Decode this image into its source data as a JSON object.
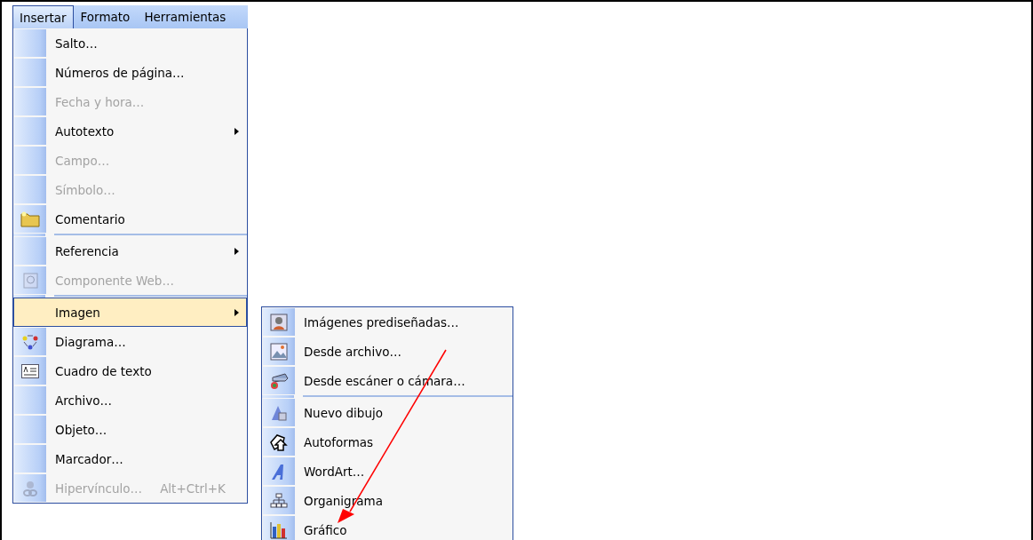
{
  "menubar": [
    {
      "label": "Insertar",
      "selected": true
    },
    {
      "label": "Formato",
      "selected": false
    },
    {
      "label": "Herramientas",
      "selected": false
    }
  ],
  "menu": [
    {
      "kind": "item",
      "label": "Salto…",
      "disabled": false,
      "has_submenu": false,
      "selected": false
    },
    {
      "kind": "item",
      "label": "Números de página…",
      "disabled": false,
      "has_submenu": false,
      "selected": false
    },
    {
      "kind": "item",
      "label": "Fecha y hora…",
      "disabled": true,
      "has_submenu": false,
      "selected": false
    },
    {
      "kind": "item",
      "label": "Autotexto",
      "disabled": false,
      "has_submenu": true,
      "selected": false
    },
    {
      "kind": "item",
      "label": "Campo…",
      "disabled": true,
      "has_submenu": false,
      "selected": false
    },
    {
      "kind": "item",
      "label": "Símbolo…",
      "disabled": true,
      "has_submenu": false,
      "selected": false
    },
    {
      "kind": "item",
      "label": "Comentario",
      "disabled": false,
      "has_submenu": false,
      "selected": false
    },
    {
      "kind": "separator"
    },
    {
      "kind": "item",
      "label": "Referencia",
      "disabled": false,
      "has_submenu": true,
      "selected": false
    },
    {
      "kind": "item",
      "label": "Componente Web…",
      "disabled": true,
      "has_submenu": false,
      "selected": false
    },
    {
      "kind": "separator"
    },
    {
      "kind": "item",
      "label": "Imagen",
      "disabled": false,
      "has_submenu": true,
      "selected": true
    },
    {
      "kind": "item",
      "label": "Diagrama…",
      "disabled": false,
      "has_submenu": false,
      "selected": false
    },
    {
      "kind": "item",
      "label": "Cuadro de texto",
      "disabled": false,
      "has_submenu": false,
      "selected": false
    },
    {
      "kind": "item",
      "label": "Archivo…",
      "disabled": false,
      "has_submenu": false,
      "selected": false
    },
    {
      "kind": "item",
      "label": "Objeto…",
      "disabled": false,
      "has_submenu": false,
      "selected": false
    },
    {
      "kind": "item",
      "label": "Marcador…",
      "disabled": false,
      "has_submenu": false,
      "selected": false
    },
    {
      "kind": "item",
      "label": "Hipervínculo…",
      "shortcut": "Alt+Ctrl+K",
      "disabled": true,
      "has_submenu": false,
      "selected": false
    }
  ],
  "submenu": [
    {
      "kind": "item",
      "label": "Imágenes prediseñadas…"
    },
    {
      "kind": "item",
      "label": "Desde archivo…"
    },
    {
      "kind": "item",
      "label": "Desde escáner o cámara…"
    },
    {
      "kind": "separator"
    },
    {
      "kind": "item",
      "label": "Nuevo dibujo"
    },
    {
      "kind": "item",
      "label": "Autoformas"
    },
    {
      "kind": "item",
      "label": "WordArt…"
    },
    {
      "kind": "item",
      "label": "Organigrama"
    },
    {
      "kind": "item",
      "label": "Gráfico"
    }
  ]
}
